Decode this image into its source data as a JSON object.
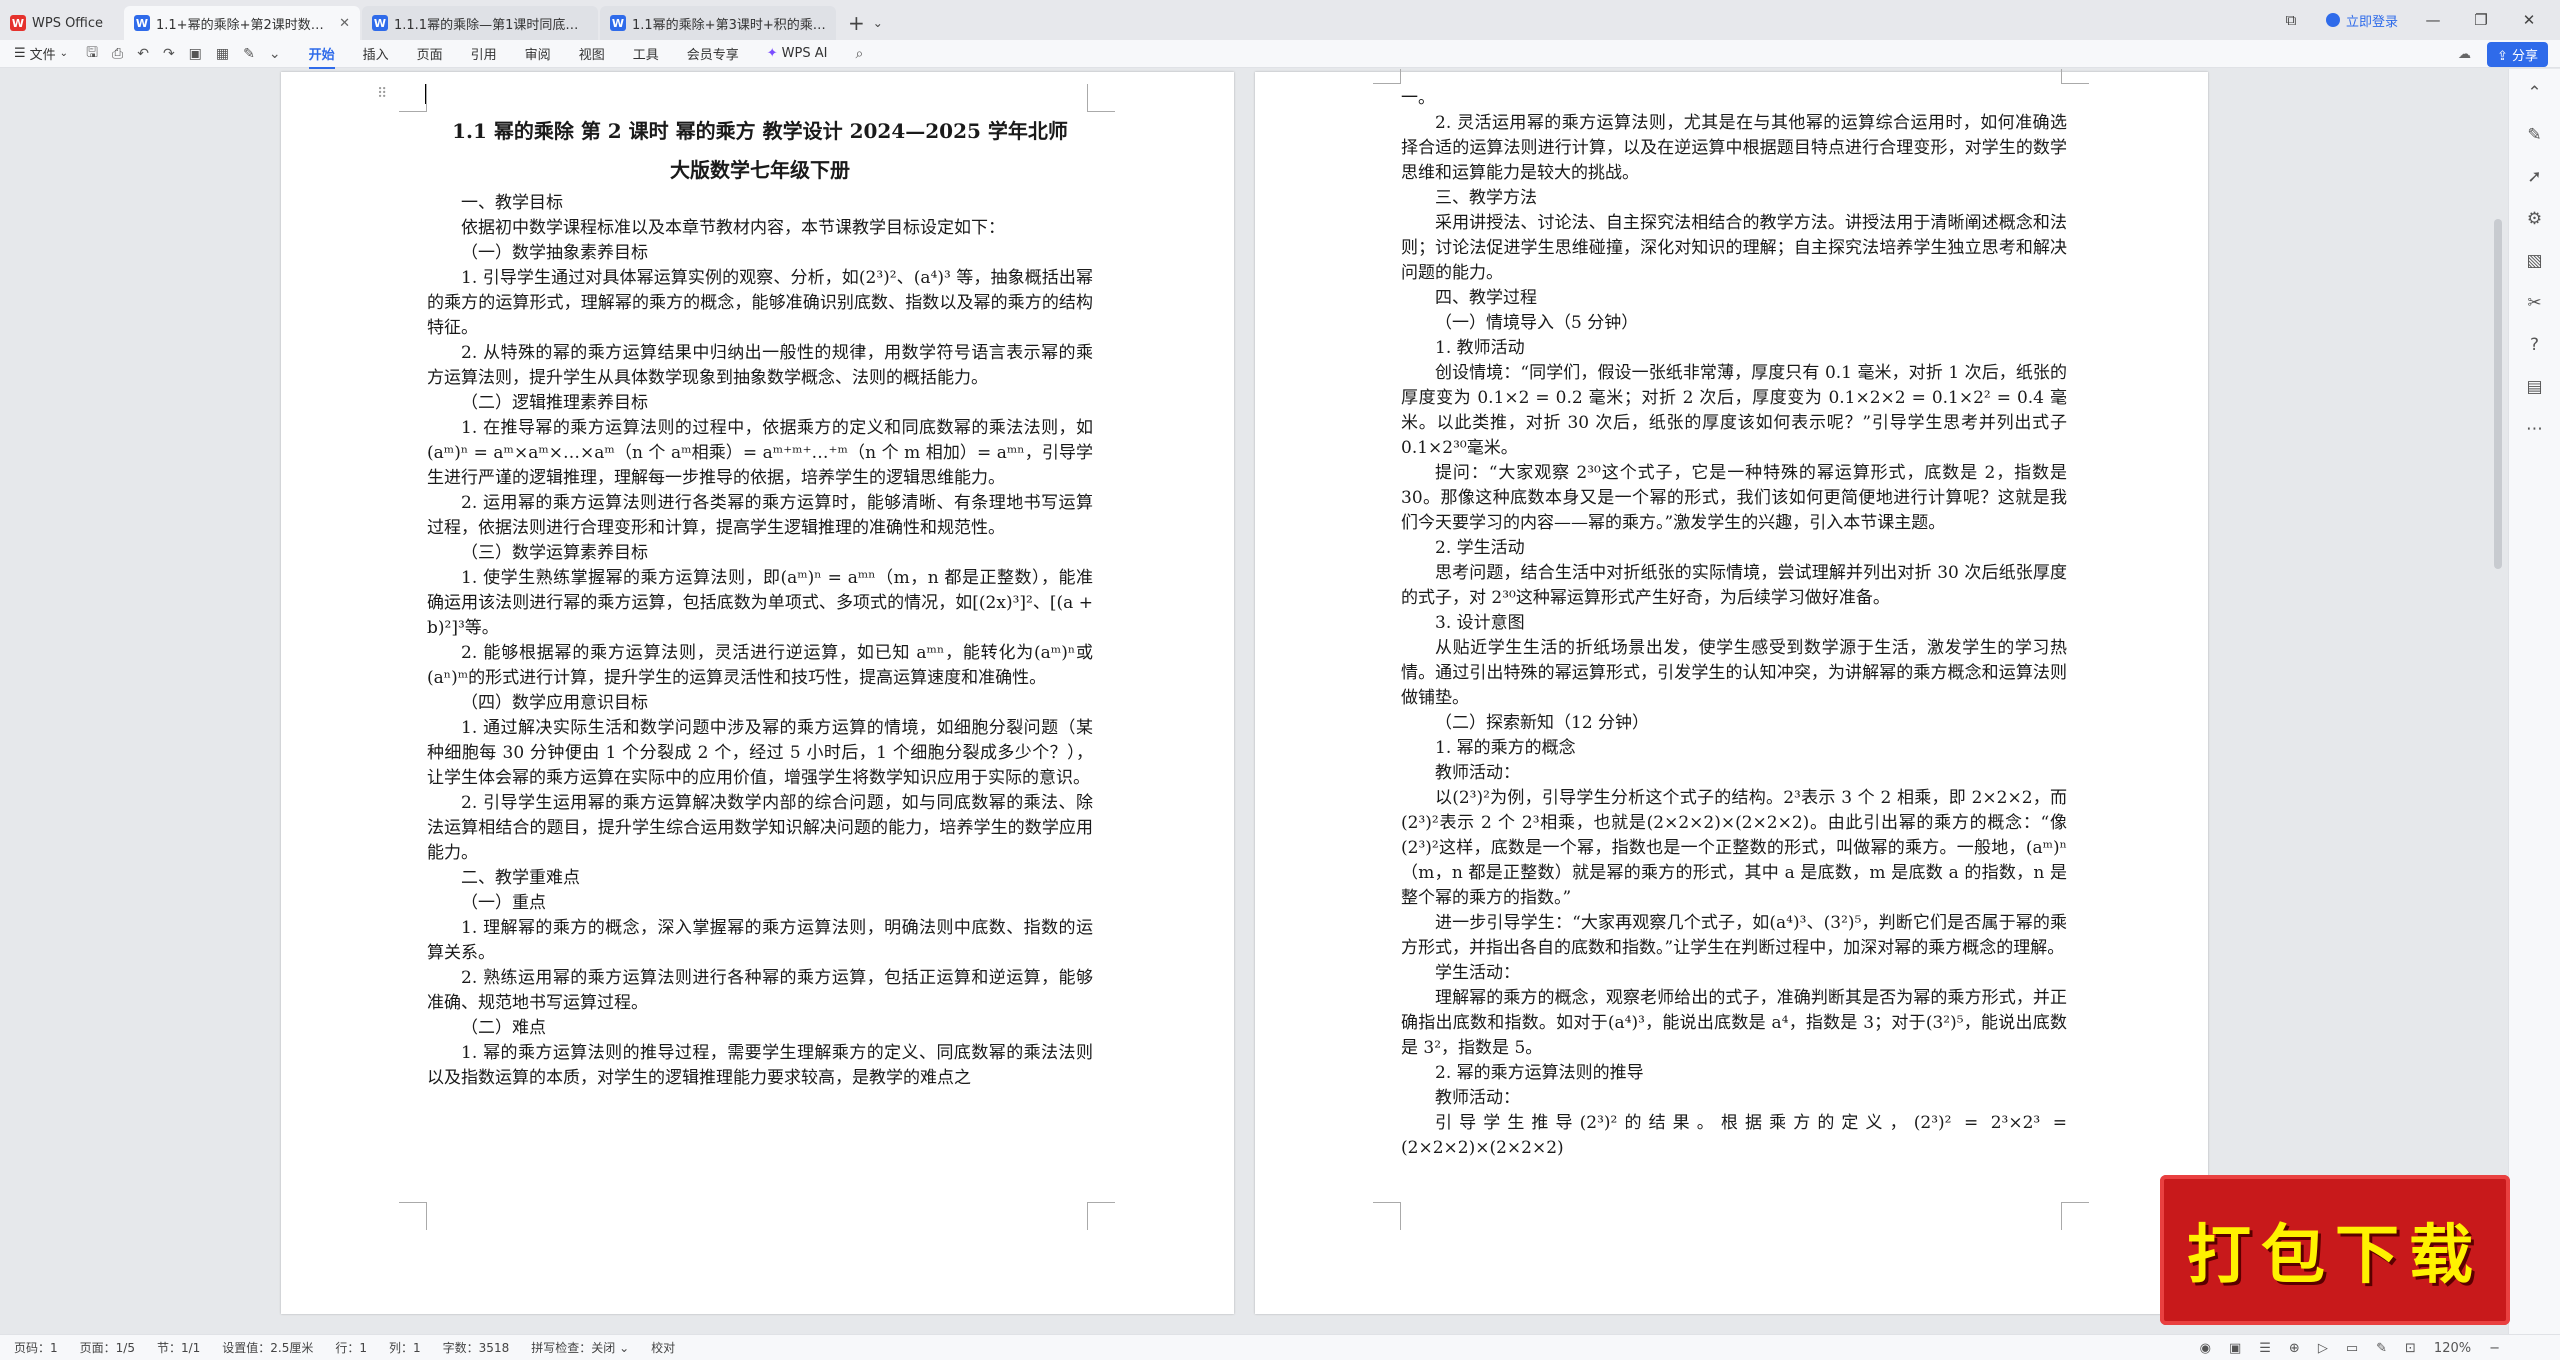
{
  "tabs": {
    "home": "WPS Office",
    "doc1": "1.1+幂的乘除+第2课时数学设",
    "doc2": "1.1.1幂的乘除—第1课时同底数幂乘",
    "doc3": "1.1幂的乘除+第3课时+积的乘方+教",
    "new_tab": "+"
  },
  "title_right": {
    "login": "立即登录"
  },
  "ribbon": {
    "file": "文件",
    "menus": [
      "开始",
      "插入",
      "页面",
      "引用",
      "审阅",
      "视图",
      "工具",
      "会员专享"
    ],
    "ai": "WPS AI",
    "share": "分享"
  },
  "left_page": {
    "title_line1": "1.1 幂的乘除 第 2 课时 幂的乘方 教学设计 2024—2025 学年北师",
    "title_line2": "大版数学七年级下册",
    "paragraphs": [
      {
        "cls": "h1",
        "text": "一、教学目标"
      },
      {
        "cls": "p",
        "text": "依据初中数学课程标准以及本章节教材内容，本节课教学目标设定如下："
      },
      {
        "cls": "h2",
        "text": "（一）数学抽象素养目标"
      },
      {
        "cls": "p",
        "text": "1. 引导学生通过对具体幂运算实例的观察、分析，如(2³)²、(a⁴)³ 等，抽象概括出幂的乘方的运算形式，理解幂的乘方的概念，能够准确识别底数、指数以及幂的乘方的结构特征。"
      },
      {
        "cls": "p",
        "text": "2. 从特殊的幂的乘方运算结果中归纳出一般性的规律，用数学符号语言表示幂的乘方运算法则，提升学生从具体数学现象到抽象数学概念、法则的概括能力。"
      },
      {
        "cls": "h2",
        "text": "（二）逻辑推理素养目标"
      },
      {
        "cls": "p",
        "text": "1. 在推导幂的乘方运算法则的过程中，依据乘方的定义和同底数幂的乘法法则，如(aᵐ)ⁿ = aᵐ×aᵐ×…×aᵐ（n 个 aᵐ相乘）= aᵐ⁺ᵐ⁺…⁺ᵐ（n 个 m 相加）= aᵐⁿ，引导学生进行严谨的逻辑推理，理解每一步推导的依据，培养学生的逻辑思维能力。"
      },
      {
        "cls": "p",
        "text": "2. 运用幂的乘方运算法则进行各类幂的乘方运算时，能够清晰、有条理地书写运算过程，依据法则进行合理变形和计算，提高学生逻辑推理的准确性和规范性。"
      },
      {
        "cls": "h2",
        "text": "（三）数学运算素养目标"
      },
      {
        "cls": "p",
        "text": "1. 使学生熟练掌握幂的乘方运算法则，即(aᵐ)ⁿ = aᵐⁿ（m，n 都是正整数），能准确运用该法则进行幂的乘方运算，包括底数为单项式、多项式的情况，如[(2x)³]²、[(a + b)²]³等。"
      },
      {
        "cls": "p",
        "text": "2. 能够根据幂的乘方运算法则，灵活进行逆运算，如已知 aᵐⁿ，能转化为(aᵐ)ⁿ或(aⁿ)ᵐ的形式进行计算，提升学生的运算灵活性和技巧性，提高运算速度和准确性。"
      },
      {
        "cls": "h2",
        "text": "（四）数学应用意识目标"
      },
      {
        "cls": "p",
        "text": "1. 通过解决实际生活和数学问题中涉及幂的乘方运算的情境，如细胞分裂问题（某种细胞每 30 分钟便由 1 个分裂成 2 个，经过 5 小时后，1 个细胞分裂成多少个？），让学生体会幂的乘方运算在实际中的应用价值，增强学生将数学知识应用于实际的意识。"
      },
      {
        "cls": "p",
        "text": "2. 引导学生运用幂的乘方运算解决数学内部的综合问题，如与同底数幂的乘法、除法运算相结合的题目，提升学生综合运用数学知识解决问题的能力，培养学生的数学应用能力。"
      },
      {
        "cls": "h1",
        "text": "二、教学重难点"
      },
      {
        "cls": "h2",
        "text": "（一）重点"
      },
      {
        "cls": "p",
        "text": "1. 理解幂的乘方的概念，深入掌握幂的乘方运算法则，明确法则中底数、指数的运算关系。"
      },
      {
        "cls": "p",
        "text": "2. 熟练运用幂的乘方运算法则进行各种幂的乘方运算，包括正运算和逆运算，能够准确、规范地书写运算过程。"
      },
      {
        "cls": "h2",
        "text": "（二）难点"
      },
      {
        "cls": "p",
        "text": "1. 幂的乘方运算法则的推导过程，需要学生理解乘方的定义、同底数幂的乘法法则以及指数运算的本质，对学生的逻辑推理能力要求较高，是教学的难点之"
      }
    ]
  },
  "right_page": {
    "paragraphs": [
      {
        "cls": "p0",
        "text": "一。"
      },
      {
        "cls": "p",
        "text": "2. 灵活运用幂的乘方运算法则，尤其是在与其他幂的运算综合运用时，如何准确选择合适的运算法则进行计算，以及在逆运算中根据题目特点进行合理变形，对学生的数学思维和运算能力是较大的挑战。"
      },
      {
        "cls": "h1",
        "text": "三、教学方法"
      },
      {
        "cls": "p",
        "text": "采用讲授法、讨论法、自主探究法相结合的教学方法。讲授法用于清晰阐述概念和法则；讨论法促进学生思维碰撞，深化对知识的理解；自主探究法培养学生独立思考和解决问题的能力。"
      },
      {
        "cls": "h1",
        "text": "四、教学过程"
      },
      {
        "cls": "h2",
        "text": "（一）情境导入（5 分钟）"
      },
      {
        "cls": "h2",
        "text": "1. 教师活动"
      },
      {
        "cls": "p",
        "text": "创设情境：“同学们，假设一张纸非常薄，厚度只有 0.1 毫米，对折 1 次后，纸张的厚度变为 0.1×2 = 0.2 毫米；对折 2 次后，厚度变为 0.1×2×2 = 0.1×2² = 0.4 毫米。以此类推，对折 30 次后，纸张的厚度该如何表示呢？”引导学生思考并列出式子 0.1×2³⁰毫米。"
      },
      {
        "cls": "p",
        "text": "提问：“大家观察 2³⁰这个式子，它是一种特殊的幂运算形式，底数是 2，指数是 30。那像这种底数本身又是一个幂的形式，我们该如何更简便地进行计算呢？这就是我们今天要学习的内容——幂的乘方。”激发学生的兴趣，引入本节课主题。"
      },
      {
        "cls": "h2",
        "text": "2. 学生活动"
      },
      {
        "cls": "p",
        "text": "思考问题，结合生活中对折纸张的实际情境，尝试理解并列出对折 30 次后纸张厚度的式子，对 2³⁰这种幂运算形式产生好奇，为后续学习做好准备。"
      },
      {
        "cls": "h2",
        "text": "3. 设计意图"
      },
      {
        "cls": "p",
        "text": "从贴近学生生活的折纸场景出发，使学生感受到数学源于生活，激发学生的学习热情。通过引出特殊的幂运算形式，引发学生的认知冲突，为讲解幂的乘方概念和运算法则做铺垫。"
      },
      {
        "cls": "h2",
        "text": "（二）探索新知（12 分钟）"
      },
      {
        "cls": "h2",
        "text": "1. 幂的乘方的概念"
      },
      {
        "cls": "h2",
        "text": "教师活动："
      },
      {
        "cls": "p",
        "text": "以(2³)²为例，引导学生分析这个式子的结构。2³表示 3 个 2 相乘，即 2×2×2，而(2³)²表示 2 个 2³相乘，也就是(2×2×2)×(2×2×2)。由此引出幂的乘方的概念：“像(2³)²这样，底数是一个幂，指数也是一个正整数的形式，叫做幂的乘方。一般地，(aᵐ)ⁿ（m，n 都是正整数）就是幂的乘方的形式，其中 a 是底数，m 是底数 a 的指数，n 是整个幂的乘方的指数。”"
      },
      {
        "cls": "p",
        "text": "进一步引导学生：“大家再观察几个式子，如(a⁴)³、(3²)⁵，判断它们是否属于幂的乘方形式，并指出各自的底数和指数。”让学生在判断过程中，加深对幂的乘方概念的理解。"
      },
      {
        "cls": "h2",
        "text": "学生活动："
      },
      {
        "cls": "p",
        "text": "理解幂的乘方的概念，观察老师给出的式子，准确判断其是否为幂的乘方形式，并正确指出底数和指数。如对于(a⁴)³，能说出底数是 a⁴，指数是 3；对于(3²)⁵，能说出底数是 3²，指数是 5。"
      },
      {
        "cls": "h2",
        "text": "2. 幂的乘方运算法则的推导"
      },
      {
        "cls": "h2",
        "text": "教师活动："
      },
      {
        "cls": "p",
        "text": "引导学生推导(2³)²的结果。根据乘方的定义，(2³)² = 2³×2³ = (2×2×2)×(2×2×2)"
      }
    ]
  },
  "statusbar": {
    "page_num": "页码：1",
    "pages": "页面：1/5",
    "section": "节：1/1",
    "setting": "设置值：2.5厘米",
    "row": "行：1",
    "col": "列：1",
    "word_count": "字数：3518",
    "spell": "拼写检查：关闭",
    "proof": "校对",
    "zoom": "120%"
  },
  "ad": {
    "text": "打包下载"
  },
  "colors": {
    "accent": "#2f6bea",
    "wps_red": "#e5322d",
    "ad_red": "#c8191b",
    "ad_yellow": "#fff200"
  }
}
